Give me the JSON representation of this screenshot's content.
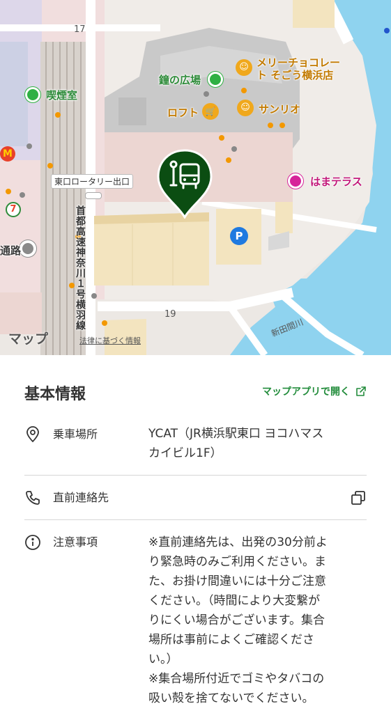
{
  "map": {
    "brand": "マップ",
    "legal": "法律に基づく情報",
    "labels": {
      "bell_square": "鐘の広場",
      "merry_line1": "メリーチョコレー",
      "merry_line2": "ト そごう横浜店",
      "smoking": "喫煙室",
      "loft": "ロフト",
      "sanrio": "サンリオ",
      "east_rotary": "東口ロータリー出口",
      "hama_terrace": "はまテラス",
      "road_fragment": "通路",
      "expressway": "首都高速神奈川１号横羽線",
      "river": "新田間川",
      "road_17": "17",
      "road_19": "19"
    },
    "colors": {
      "pin": "#0b4d12",
      "water": "#8fd3ef",
      "building": "#c9c9c9",
      "highlight": "#f3e4bf"
    }
  },
  "info": {
    "title": "基本情報",
    "open_link": "マップアプリで開く",
    "rows": [
      {
        "icon": "location-pin-icon",
        "label": "乗車場所",
        "value_lines": [
          "YCAT（JR横浜駅東口 ヨコハマス",
          "カイビル1F）"
        ]
      },
      {
        "icon": "phone-icon",
        "label": "直前連絡先",
        "value_lines": []
      },
      {
        "icon": "info-circle-icon",
        "label": "注意事項",
        "value_lines": [
          "※直前連絡先は、出発の30分前よ",
          "り緊急時のみご利用ください。ま",
          "た、お掛け間違いには十分ご注意",
          "ください。（時間により大変繋が",
          "りにくい場合がございます。集合",
          "場所は事前によくご確認くださ",
          "い。）",
          "※集合場所付近でゴミやタバコの",
          "吸い殻を捨てないでください。"
        ]
      }
    ]
  }
}
